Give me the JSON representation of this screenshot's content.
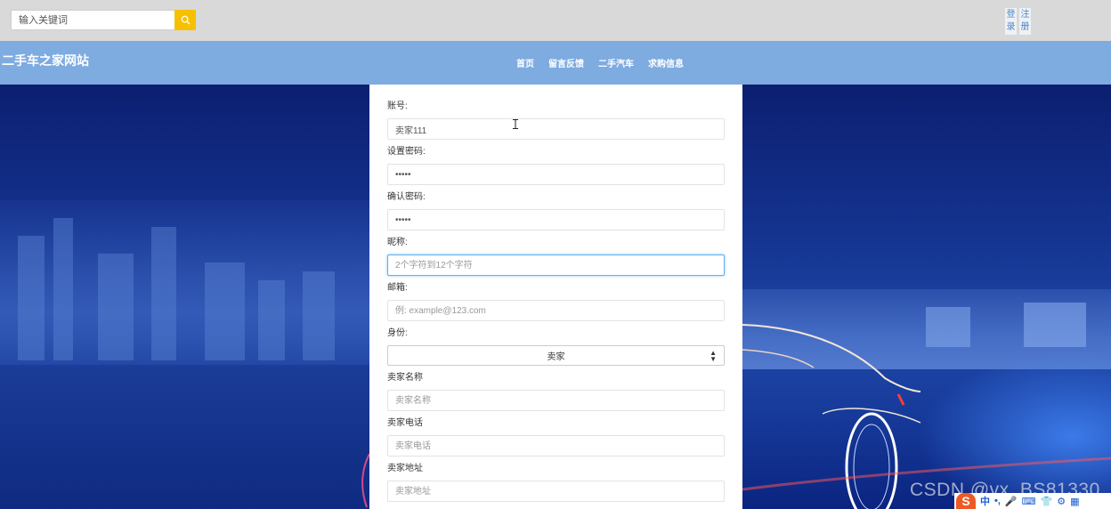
{
  "search": {
    "placeholder": "输入关键词"
  },
  "auth": {
    "login_label": "登录",
    "register_label": "注册"
  },
  "site": {
    "title": "二手车之家网站"
  },
  "nav": {
    "items": [
      {
        "label": "首页"
      },
      {
        "label": "留言反馈"
      },
      {
        "label": "二手汽车"
      },
      {
        "label": "求购信息"
      }
    ]
  },
  "form": {
    "account": {
      "label": "账号:",
      "value": "卖家111"
    },
    "password": {
      "label": "设置密码:",
      "value": "•••••"
    },
    "confirm_password": {
      "label": "确认密码:",
      "value": "•••••"
    },
    "nickname": {
      "label": "昵称:",
      "placeholder": "2个字符到12个字符"
    },
    "email": {
      "label": "邮箱:",
      "placeholder": "例: example@123.com"
    },
    "identity": {
      "label": "身份:",
      "selected": "卖家"
    },
    "seller_name": {
      "label": "卖家名称",
      "placeholder": "卖家名称"
    },
    "seller_phone": {
      "label": "卖家电话",
      "placeholder": "卖家电话"
    },
    "seller_address": {
      "label": "卖家地址",
      "placeholder": "卖家地址"
    }
  },
  "watermark": "CSDN @vx_BS81330",
  "ime": {
    "logo": "S",
    "mode": "中",
    "glyphs": [
      "•,",
      "🎤",
      "⌨",
      "👕",
      "⚙",
      "▦",
      "…"
    ]
  },
  "colors": {
    "topbar": "#d9d9d9",
    "navbar": "#7eabe0",
    "search_button": "#f6c000",
    "focus_border": "#66afe9"
  }
}
